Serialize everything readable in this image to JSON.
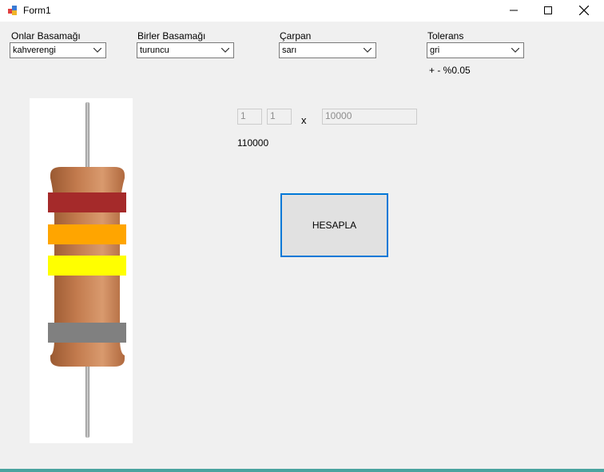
{
  "window": {
    "title": "Form1"
  },
  "labels": {
    "onlar": "Onlar Basamağı",
    "birler": "Birler Basamağı",
    "carpan": "Çarpan",
    "tolerans": "Tolerans"
  },
  "combos": {
    "onlar": "kahverengi",
    "birler": "turuncu",
    "carpan": "sarı",
    "tolerans": "gri"
  },
  "tolerance_text": "+ - %0.05",
  "digits": {
    "first": "1",
    "second": "1",
    "multiplier": "10000"
  },
  "operator": "x",
  "result": "110000",
  "button": {
    "label": "HESAPLA"
  },
  "colors": {
    "band1": "#a52a2a",
    "band2": "#ffa500",
    "band3": "#ffff00",
    "band4": "#808080",
    "button_border": "#0078d7"
  }
}
